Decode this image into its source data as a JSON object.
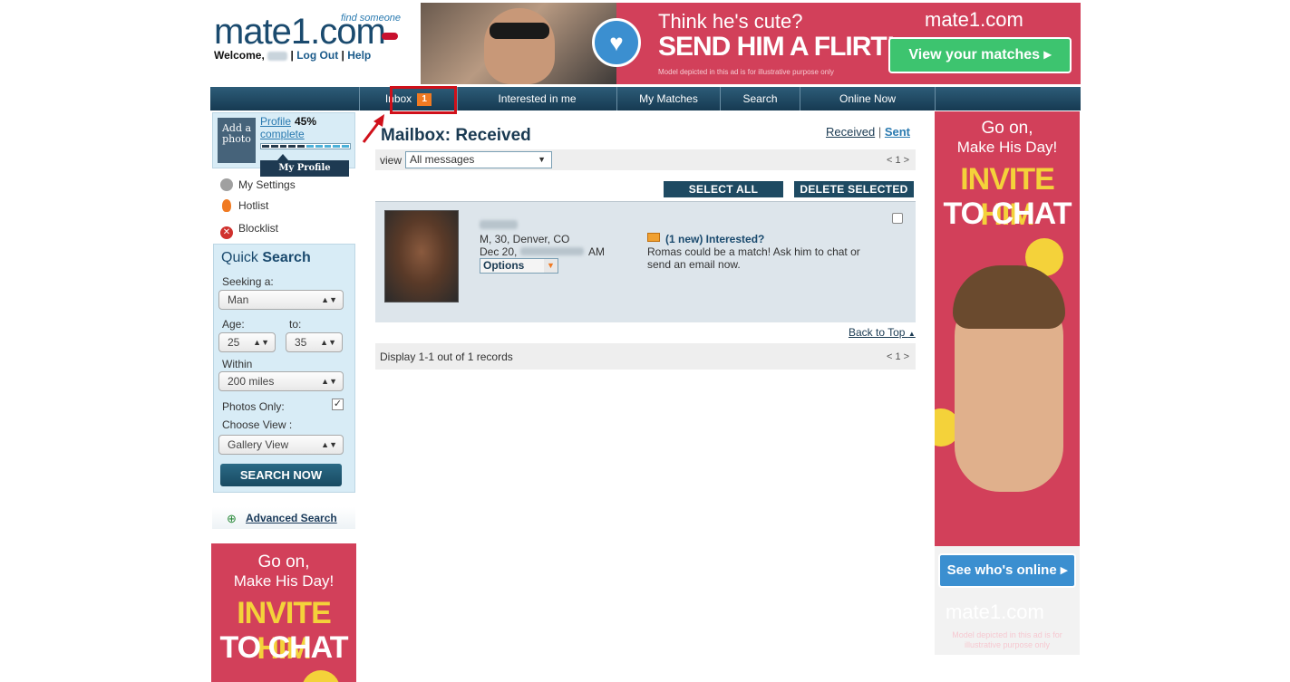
{
  "header": {
    "logo_text": "mate1.com",
    "logo_tagline": "find someone",
    "welcome": "Welcome,",
    "logout": "Log Out",
    "help": "Help",
    "separator": "|"
  },
  "top_ad": {
    "line1": "Think he's cute?",
    "line2": "SEND HIM A FLIRT!",
    "disclaimer": "Model depicted in this ad is for illustrative purpose only",
    "brand": "mate1.com",
    "cta": "View your matches ▸"
  },
  "nav": {
    "items": [
      {
        "label": "Inbox",
        "badge": "1"
      },
      {
        "label": "Interested in me"
      },
      {
        "label": "My Matches"
      },
      {
        "label": "Search"
      },
      {
        "label": "Online Now"
      }
    ]
  },
  "profile": {
    "add_photo": "Add a photo",
    "link": "Profile",
    "percent": "45%",
    "complete": "complete",
    "progress_fraction": 0.45,
    "my_profile": "My Profile"
  },
  "sidebar": {
    "links": [
      {
        "label": "My Settings",
        "icon": "gear-icon",
        "color": "#999999"
      },
      {
        "label": "Hotlist",
        "icon": "flame-icon",
        "color": "#f07a22"
      },
      {
        "label": "Blocklist",
        "icon": "block-icon",
        "color": "#d0312d"
      }
    ]
  },
  "quick_search": {
    "title_a": "Quick",
    "title_b": "Search",
    "seeking_label": "Seeking a:",
    "seeking_value": "Man",
    "age_label": "Age:",
    "to_label": "to:",
    "age_from": "25",
    "age_to": "35",
    "within_label": "Within",
    "within_value": "200 miles",
    "photos_label": "Photos Only:",
    "photos_checked": "✓",
    "view_label": "Choose View :",
    "view_value": "Gallery View",
    "button": "SEARCH NOW",
    "advanced": "Advanced Search"
  },
  "promo_ad": {
    "line1": "Go on,",
    "line2": "Make His Day!",
    "big1": "INVITE HIM",
    "big2": "TO CHAT",
    "cta": "See who's online ▸",
    "brand": "mate1.com",
    "disclaimer": "Model depicted in this ad is for illustrative purpose only"
  },
  "mailbox": {
    "title": "Mailbox: Received",
    "received": "Received",
    "sep": "|",
    "sent": "Sent",
    "view_label": "view",
    "view_value": "All messages",
    "pager": "< 1 >",
    "select_all": "SELECT ALL",
    "delete_selected": "DELETE SELECTED",
    "message": {
      "details": "M, 30, Denver, CO",
      "date_prefix": "Dec 20,",
      "date_suffix": "AM",
      "options": "Options",
      "interest": "(1 new) Interested?",
      "text": "Romas could be a match! Ask him to chat or send an email now."
    },
    "back_to_top": "Back to Top",
    "display": "Display 1-1 out of 1 records"
  },
  "colors": {
    "nav_bg": "#1e4a62",
    "accent_orange": "#f07a22",
    "ad_red": "#d2405a",
    "ad_yellow": "#f4d23a",
    "link_blue": "#2a7ab0"
  }
}
